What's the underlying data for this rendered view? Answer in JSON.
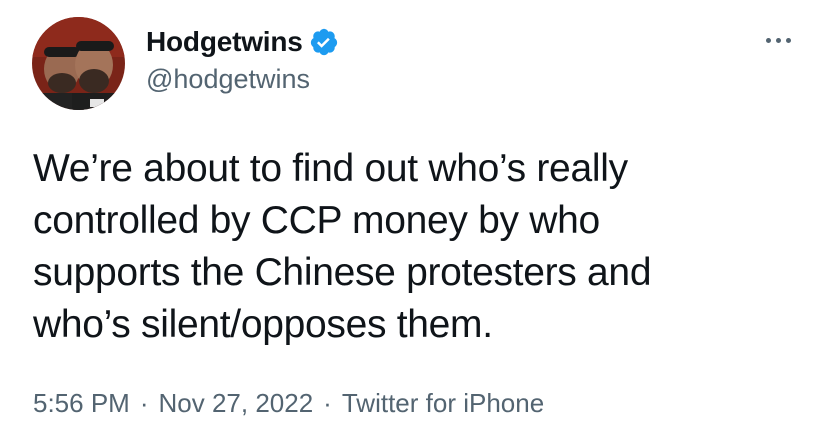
{
  "author": {
    "display_name": "Hodgetwins",
    "handle": "@hodgetwins",
    "verified": true
  },
  "tweet": {
    "text": "We’re about to find out who’s really\ncontrolled by CCP money by who\nsupports the Chinese protesters and\nwho’s silent/opposes them."
  },
  "meta": {
    "time": "5:56 PM",
    "separator": "·",
    "date": "Nov 27, 2022",
    "source": "Twitter for iPhone"
  },
  "icons": {
    "verified": "verified-badge-icon",
    "more": "more-options-icon"
  },
  "colors": {
    "verified_blue": "#1d9bf0",
    "secondary_text": "#536471",
    "primary_text": "#0f1419"
  }
}
